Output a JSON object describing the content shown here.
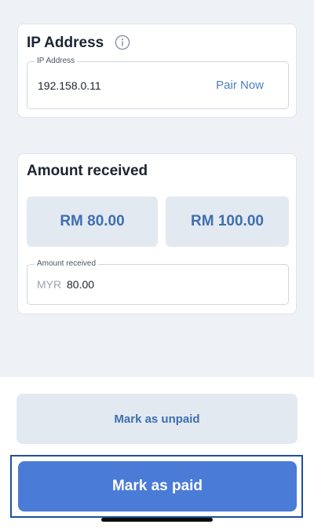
{
  "ip_card": {
    "title": "IP Address",
    "info_icon": "info-icon",
    "field_label": "IP Address",
    "ip_value": "192.158.0.11",
    "pair_label": "Pair Now"
  },
  "amount_card": {
    "title": "Amount received",
    "quick_amounts": [
      "RM 80.00",
      "RM 100.00"
    ],
    "field_label": "Amount received",
    "currency": "MYR",
    "value": "80.00"
  },
  "actions": {
    "unpaid_label": "Mark as unpaid",
    "paid_label": "Mark as paid"
  },
  "colors": {
    "accent": "#4a7bd6",
    "secondary_button": "#e3e9f1",
    "link": "#4a7fc0",
    "background": "#eef1f6"
  }
}
